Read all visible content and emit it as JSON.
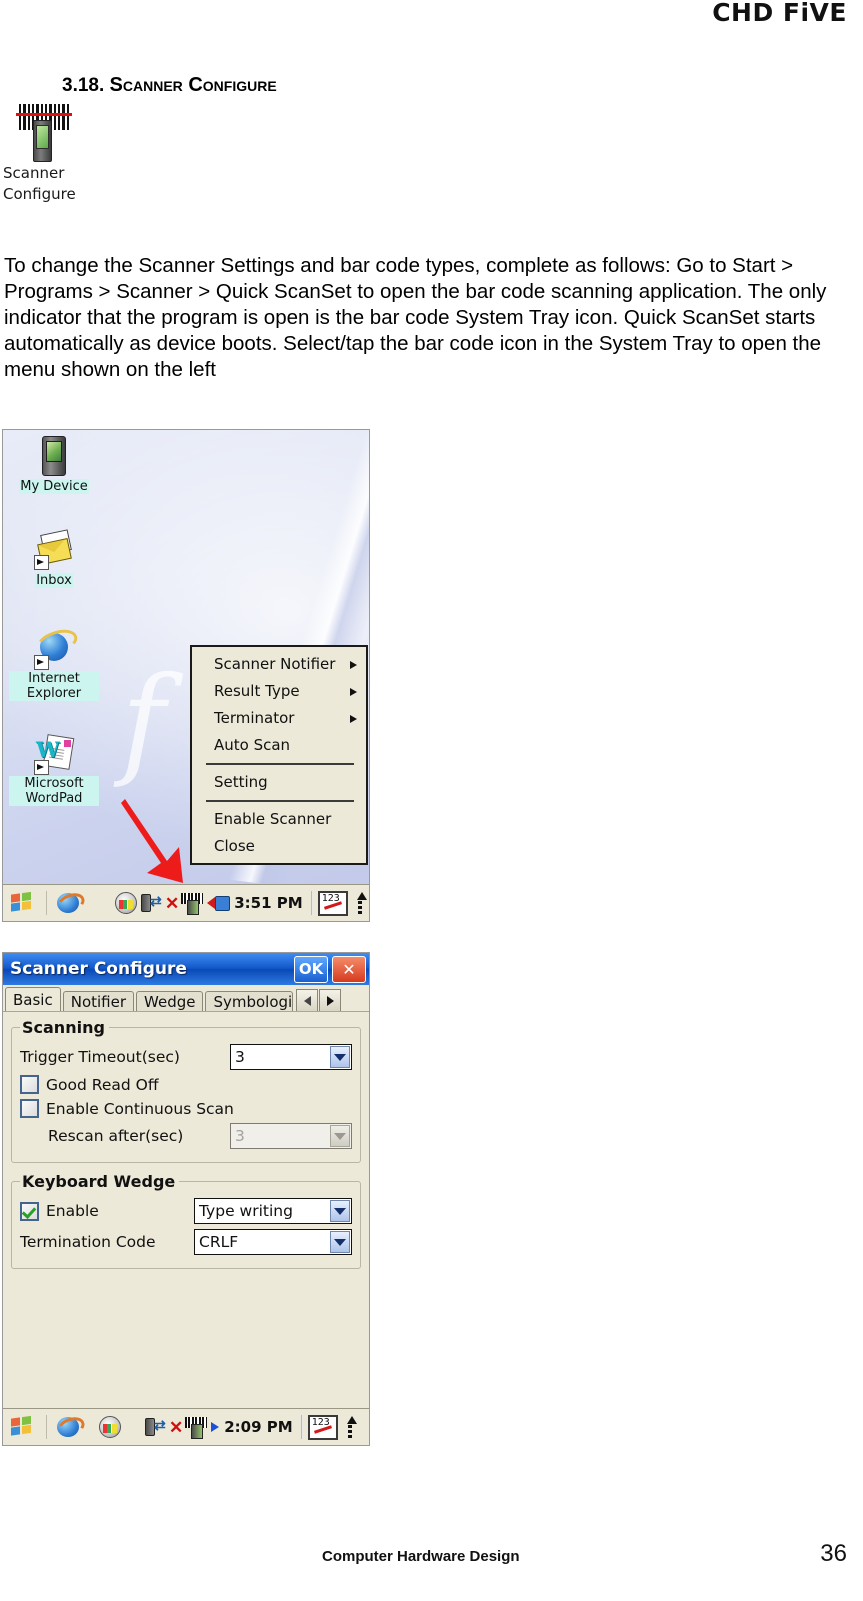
{
  "header": {
    "brand": "CHD FiVE"
  },
  "section": {
    "number": "3.18.",
    "title": "Scanner Configure"
  },
  "app_icon": {
    "name": "scanner-configure-icon",
    "label_line1": "Scanner",
    "label_line2": "Configure"
  },
  "body": {
    "paragraph": "To change the Scanner Settings and bar code types, complete as follows: Go to Start > Programs > Scanner > Quick ScanSet to open the bar code scanning application. The only indicator that the program is open is the bar code System Tray icon. Quick ScanSet starts automatically as device boots. Select/tap the bar code icon in the System Tray to open the menu shown on the left"
  },
  "desktop_shot": {
    "watermark": "f",
    "icons": [
      {
        "label": "My Device",
        "icon": "pda-icon",
        "shortcut": false
      },
      {
        "label": "Inbox",
        "icon": "envelope-icon",
        "shortcut": true
      },
      {
        "label": "Internet Explorer",
        "icon": "internet-explorer-icon",
        "shortcut": true
      },
      {
        "label": "Microsoft WordPad",
        "icon": "wordpad-icon",
        "shortcut": true
      }
    ],
    "context_menu": {
      "items": [
        {
          "label": "Scanner Notifier",
          "submenu": true
        },
        {
          "label": "Result Type",
          "submenu": true
        },
        {
          "label": "Terminator",
          "submenu": true
        },
        {
          "label": "Auto Scan",
          "submenu": false
        },
        {
          "separator": true
        },
        {
          "label": "Setting",
          "submenu": false
        },
        {
          "separator": true
        },
        {
          "label": "Enable Scanner",
          "submenu": false
        },
        {
          "label": "Close",
          "submenu": false
        }
      ]
    },
    "taskbar": {
      "start": "start-button",
      "time": "3:51 PM",
      "tray_icons": [
        "network-icon",
        "sync-icon",
        "disconnect-x-icon",
        "barcode-scanner-icon",
        "power-plug-icon",
        "sip-keyboard-icon",
        "updown-arrows-icon"
      ]
    }
  },
  "dialog_shot": {
    "titlebar": {
      "title": "Scanner Configure",
      "ok_label": "OK",
      "close_label": "✕"
    },
    "tabs": [
      {
        "label": "Basic",
        "active": true
      },
      {
        "label": "Notifier",
        "active": false
      },
      {
        "label": "Wedge",
        "active": false
      },
      {
        "label": "Symbologi",
        "active": false
      }
    ],
    "groups": {
      "scanning": {
        "legend": "Scanning",
        "trigger_timeout_label": "Trigger Timeout(sec)",
        "trigger_timeout_value": "3",
        "good_read_off_label": "Good Read Off",
        "good_read_off_checked": false,
        "enable_continuous_label": "Enable Continuous Scan",
        "enable_continuous_checked": false,
        "rescan_label": "Rescan after(sec)",
        "rescan_value": "3",
        "rescan_disabled": true
      },
      "keyboard_wedge": {
        "legend": "Keyboard Wedge",
        "enable_label": "Enable",
        "enable_checked": true,
        "mode_value": "Type writing",
        "termination_label": "Termination Code",
        "termination_value": "CRLF"
      }
    },
    "taskbar": {
      "time": "2:09 PM"
    }
  },
  "footer": {
    "text": "Computer Hardware Design",
    "page": "36"
  },
  "colors": {
    "titlebar_blue": "#0a49b6",
    "dialog_face": "#ece9d8",
    "ok_blue": "#1a5fd0",
    "close_red": "#d63a1e",
    "check_green": "#2aa02a",
    "laser_red": "#e01010",
    "icon_label_highlight": "#ccf5f0"
  }
}
